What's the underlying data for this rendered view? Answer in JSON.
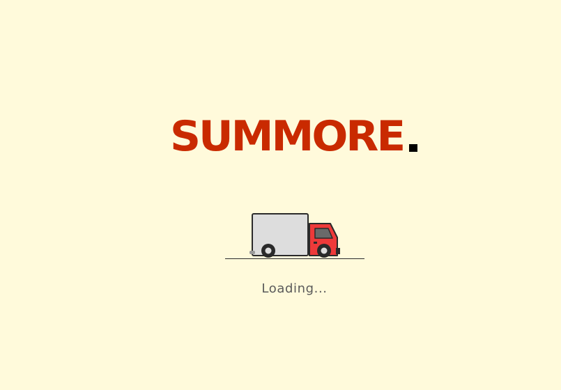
{
  "brand": {
    "logo_text": "SUMMORE",
    "logo_color": "#c92a00",
    "dot_color": "#000000"
  },
  "status": {
    "loading_text": "Loading..."
  },
  "colors": {
    "background": "#fffadb",
    "truck_box": "#dddddd",
    "truck_cab": "#ee3a3a",
    "outline": "#2a2a2a"
  },
  "icons": {
    "loader": "delivery-truck-icon"
  }
}
